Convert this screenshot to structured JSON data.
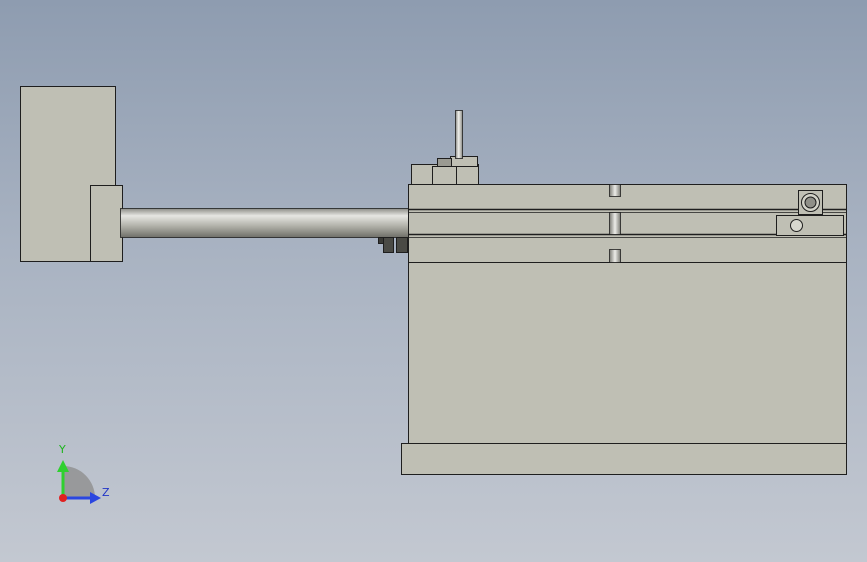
{
  "triad": {
    "y_label": "Y",
    "z_label": "Z",
    "colors": {
      "y_axis": "#2fd02f",
      "z_axis": "#2a46e0",
      "x_origin": "#e02020",
      "label_y": "#1db51d",
      "label_z": "#2034c8"
    }
  },
  "colors": {
    "background_top": "#8e9cb0",
    "background_bottom": "#c3c8d1",
    "part_face": "#bfbfb4",
    "part_edge": "#1e1e1e",
    "rod_light": "#e6e6e2",
    "rod_dark": "#6f6f68"
  }
}
